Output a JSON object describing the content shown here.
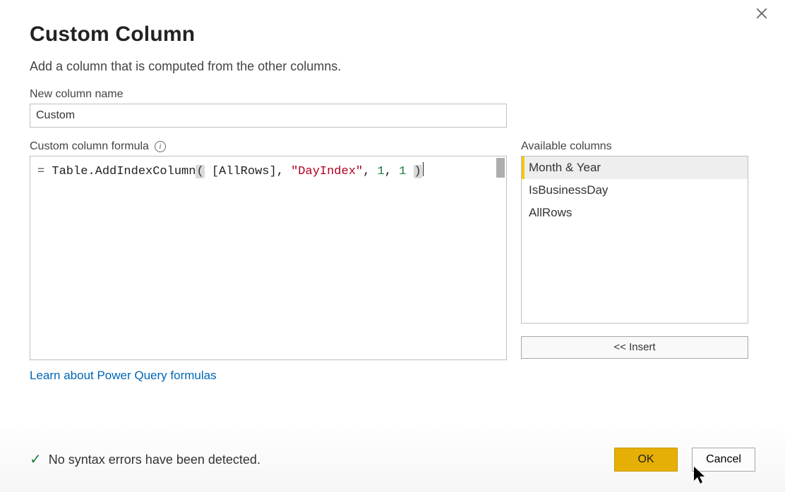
{
  "dialog": {
    "title": "Custom Column",
    "subtitle": "Add a column that is computed from the other columns.",
    "close_tooltip": "Close"
  },
  "colname": {
    "label": "New column name",
    "value": "Custom"
  },
  "formula": {
    "label": "Custom column formula",
    "info_glyph": "i",
    "prefix": "= ",
    "tokens": {
      "fn": "Table.AddIndexColumn",
      "open": "(",
      "sp1": " ",
      "arg1": "[AllRows]",
      "c1": ", ",
      "arg2": "\"DayIndex\"",
      "c2": ", ",
      "arg3": "1",
      "c3": ", ",
      "arg4": "1",
      "sp2": " ",
      "close": ")"
    }
  },
  "available": {
    "label": "Available columns",
    "items": [
      {
        "label": "Month & Year",
        "selected": true
      },
      {
        "label": "IsBusinessDay",
        "selected": false
      },
      {
        "label": "AllRows",
        "selected": false
      }
    ],
    "insert_label": "<< Insert"
  },
  "link": {
    "learn": "Learn about Power Query formulas"
  },
  "status": {
    "ok": true,
    "text": "No syntax errors have been detected."
  },
  "buttons": {
    "ok": "OK",
    "cancel": "Cancel"
  }
}
